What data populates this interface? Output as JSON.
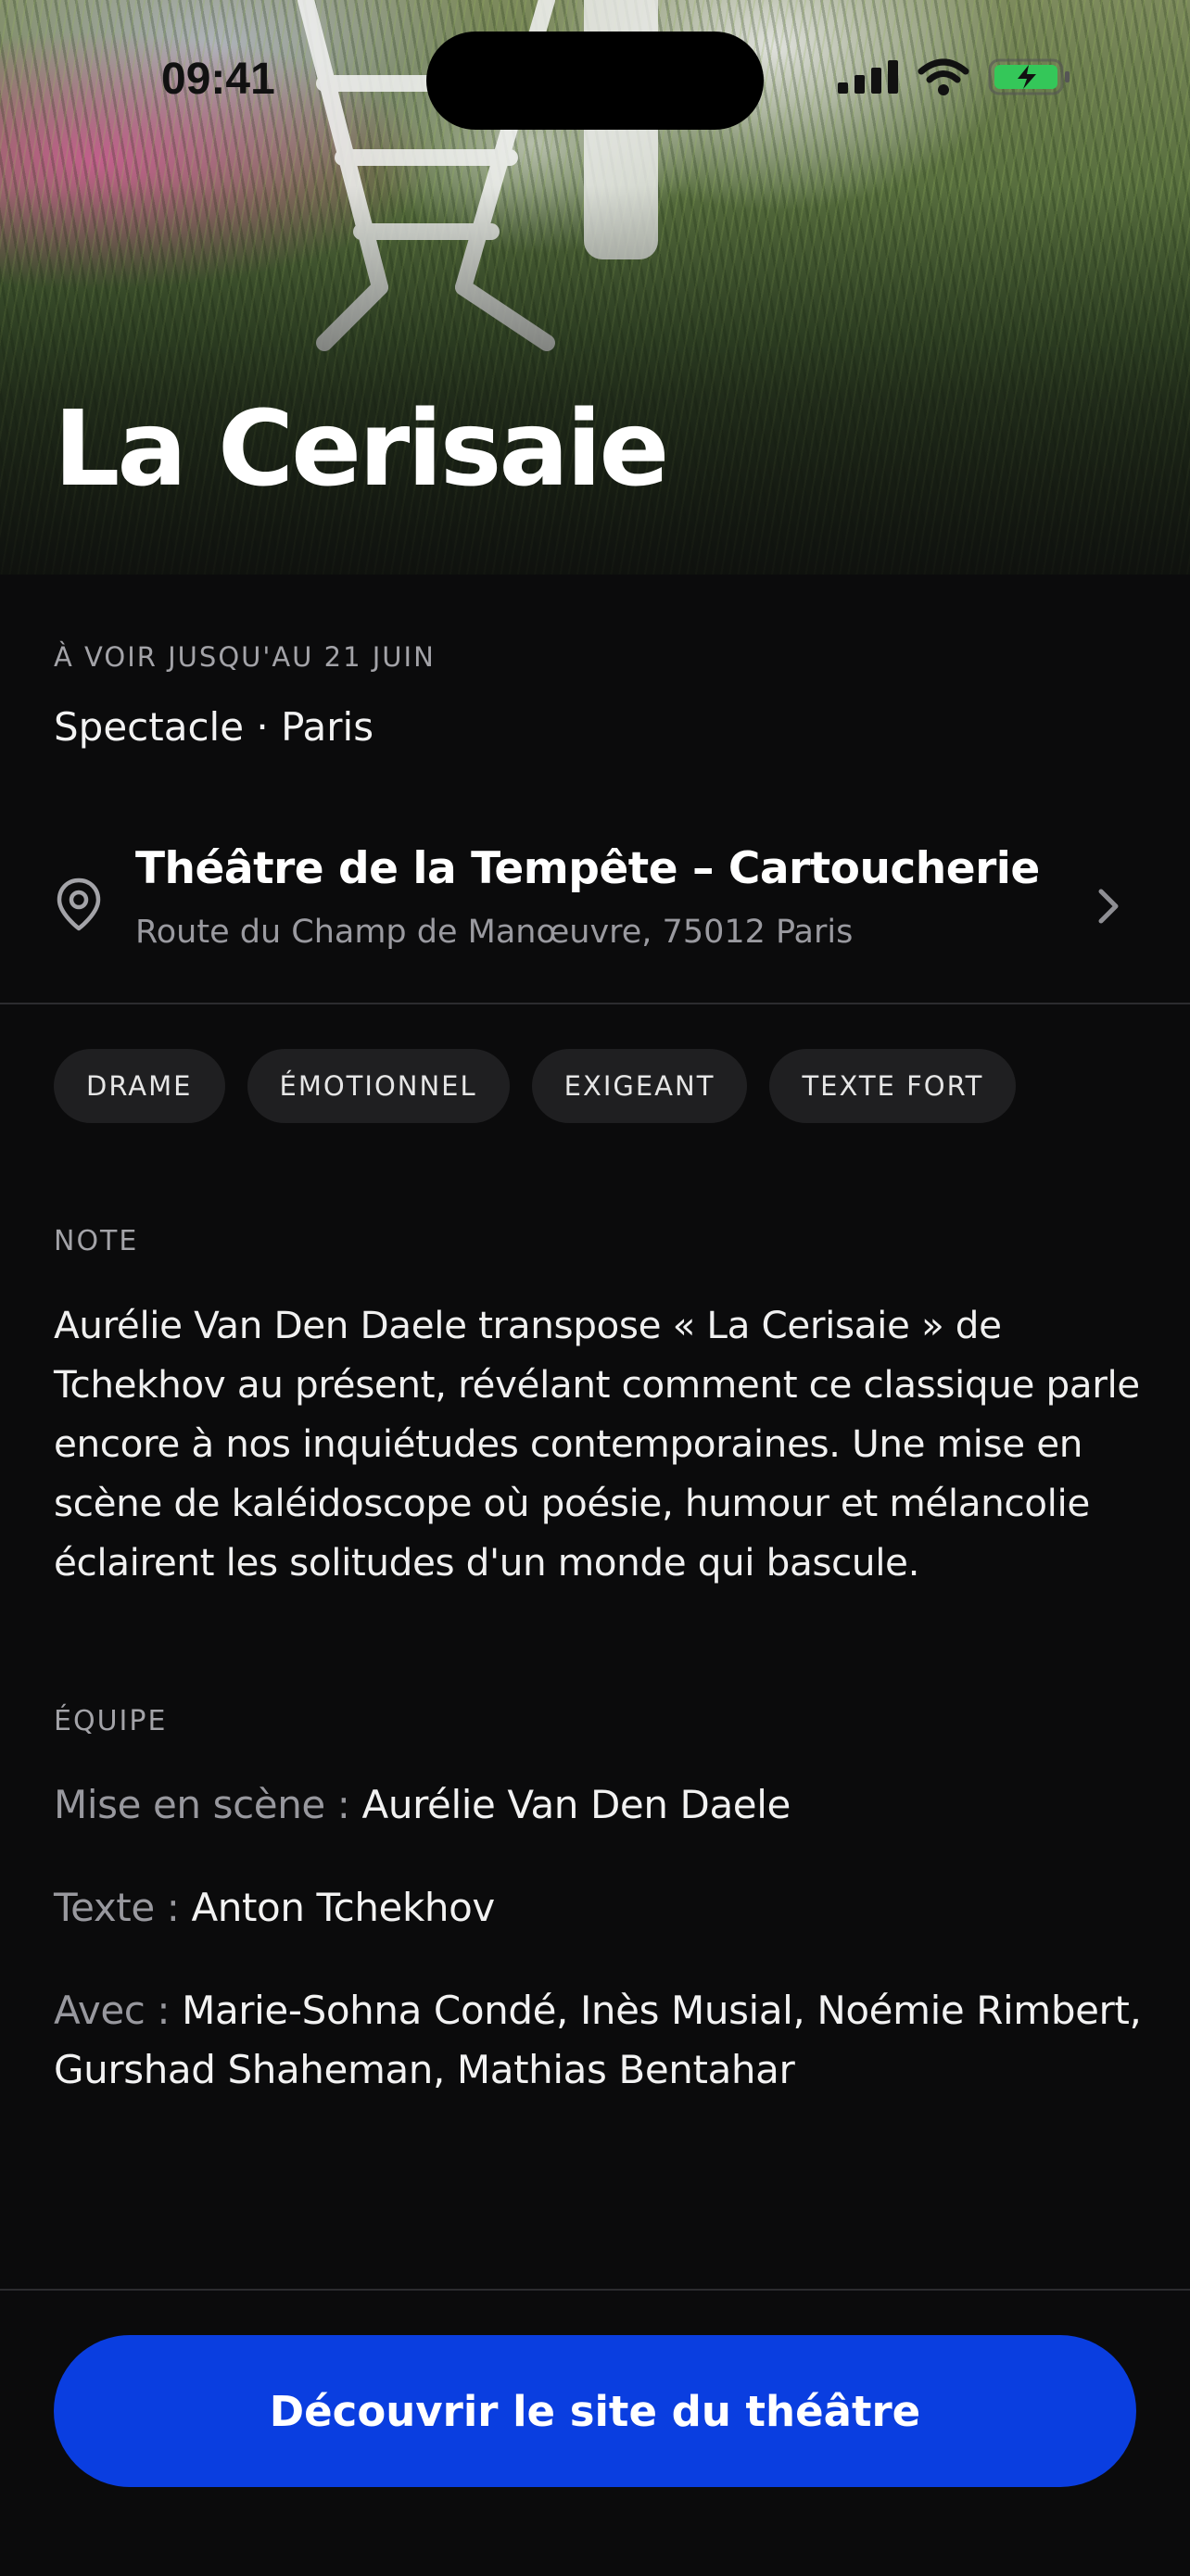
{
  "status_bar": {
    "time": "09:41",
    "icons": [
      "cellular-signal-icon",
      "wifi-icon",
      "battery-charging-icon"
    ]
  },
  "hero": {
    "title": "La Cerisaie"
  },
  "info": {
    "until": "À VOIR JUSQU'AU 21 JUIN",
    "category": "Spectacle · Paris"
  },
  "venue": {
    "name": "Théâtre de la Tempête – Cartoucherie",
    "address": "Route du Champ de Manœuvre, 75012 Paris",
    "icon": "location-pin-icon"
  },
  "tags": [
    "DRAME",
    "ÉMOTIONNEL",
    "EXIGEANT",
    "TEXTE FORT"
  ],
  "note": {
    "label": "NOTE",
    "text": "Aurélie Van Den Daele transpose « La Cerisaie » de Tchekhov au présent, révélant comment ce classique parle encore à nos inquiétudes contemporaines. Une mise en scène de kaléidoscope où poésie, humour et mélancolie éclairent les solitudes d'un monde qui bascule."
  },
  "team": {
    "label": "ÉQUIPE",
    "credits": [
      {
        "key": "Mise en scène : ",
        "value": "Aurélie Van Den Daele"
      },
      {
        "key": "Texte : ",
        "value": "Anton Tchekhov"
      },
      {
        "key": "Avec : ",
        "value": "Marie-Sohna Condé, Inès Musial, Noémie Rimbert, Gurshad Shaheman, Mathias Bentahar"
      }
    ]
  },
  "cta": {
    "label": "Découvrir le site du théâtre"
  },
  "colors": {
    "background": "#0b0b0c",
    "accent": "#0a3ee0",
    "muted_text": "#a3a3a8",
    "tag_background": "#1f1f21"
  }
}
